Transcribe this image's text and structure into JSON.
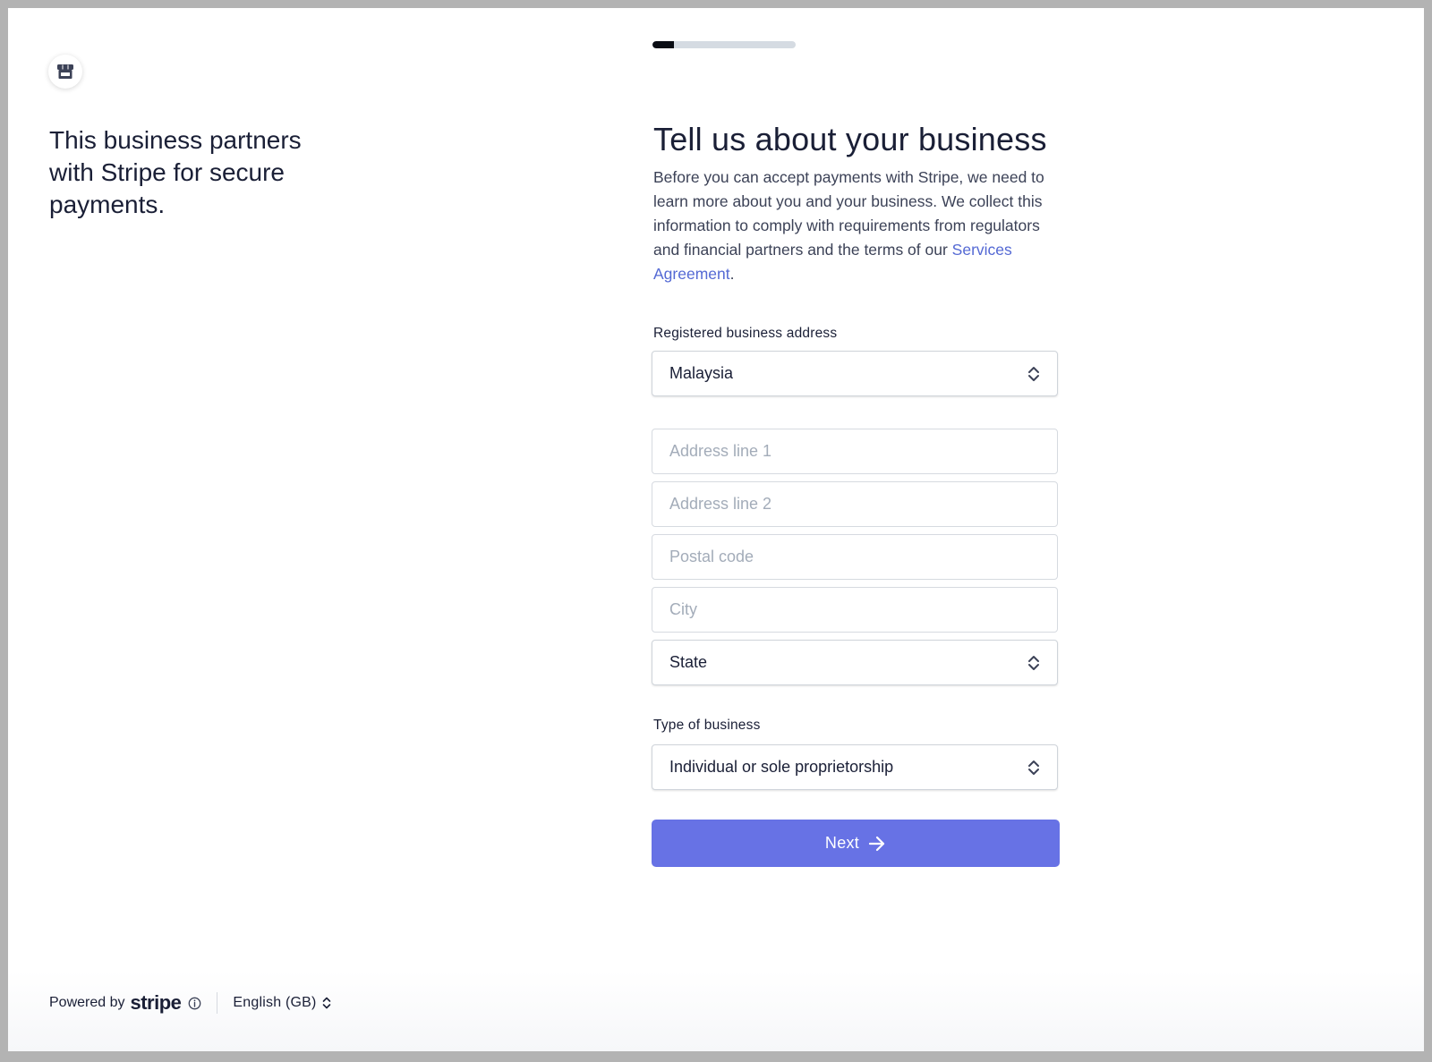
{
  "sidebar": {
    "logo_icon": "storefront-icon",
    "tagline": "This business partners with Stripe for secure payments."
  },
  "progress": {
    "value": 0.15
  },
  "form": {
    "title": "Tell us about your business",
    "intro_text": "Before you can accept payments with Stripe, we need to learn more about you and your business. We collect this information to comply with requirements from regulators and financial partners and the terms of our ",
    "intro_link": "Services Agreement",
    "intro_end": ".",
    "address_label": "Registered business address",
    "country_value": "Malaysia",
    "address_line1_placeholder": "Address line 1",
    "address_line2_placeholder": "Address line 2",
    "postal_code_placeholder": "Postal code",
    "city_placeholder": "City",
    "state_value": "State",
    "business_type_label": "Type of business",
    "business_type_value": "Individual or sole proprietorship",
    "next_label": "Next"
  },
  "footer": {
    "powered_by": "Powered by",
    "brand": "stripe",
    "language": "English (GB)"
  },
  "colors": {
    "accent": "#6772e5",
    "link": "#5469d4",
    "text": "#1a1f36"
  }
}
